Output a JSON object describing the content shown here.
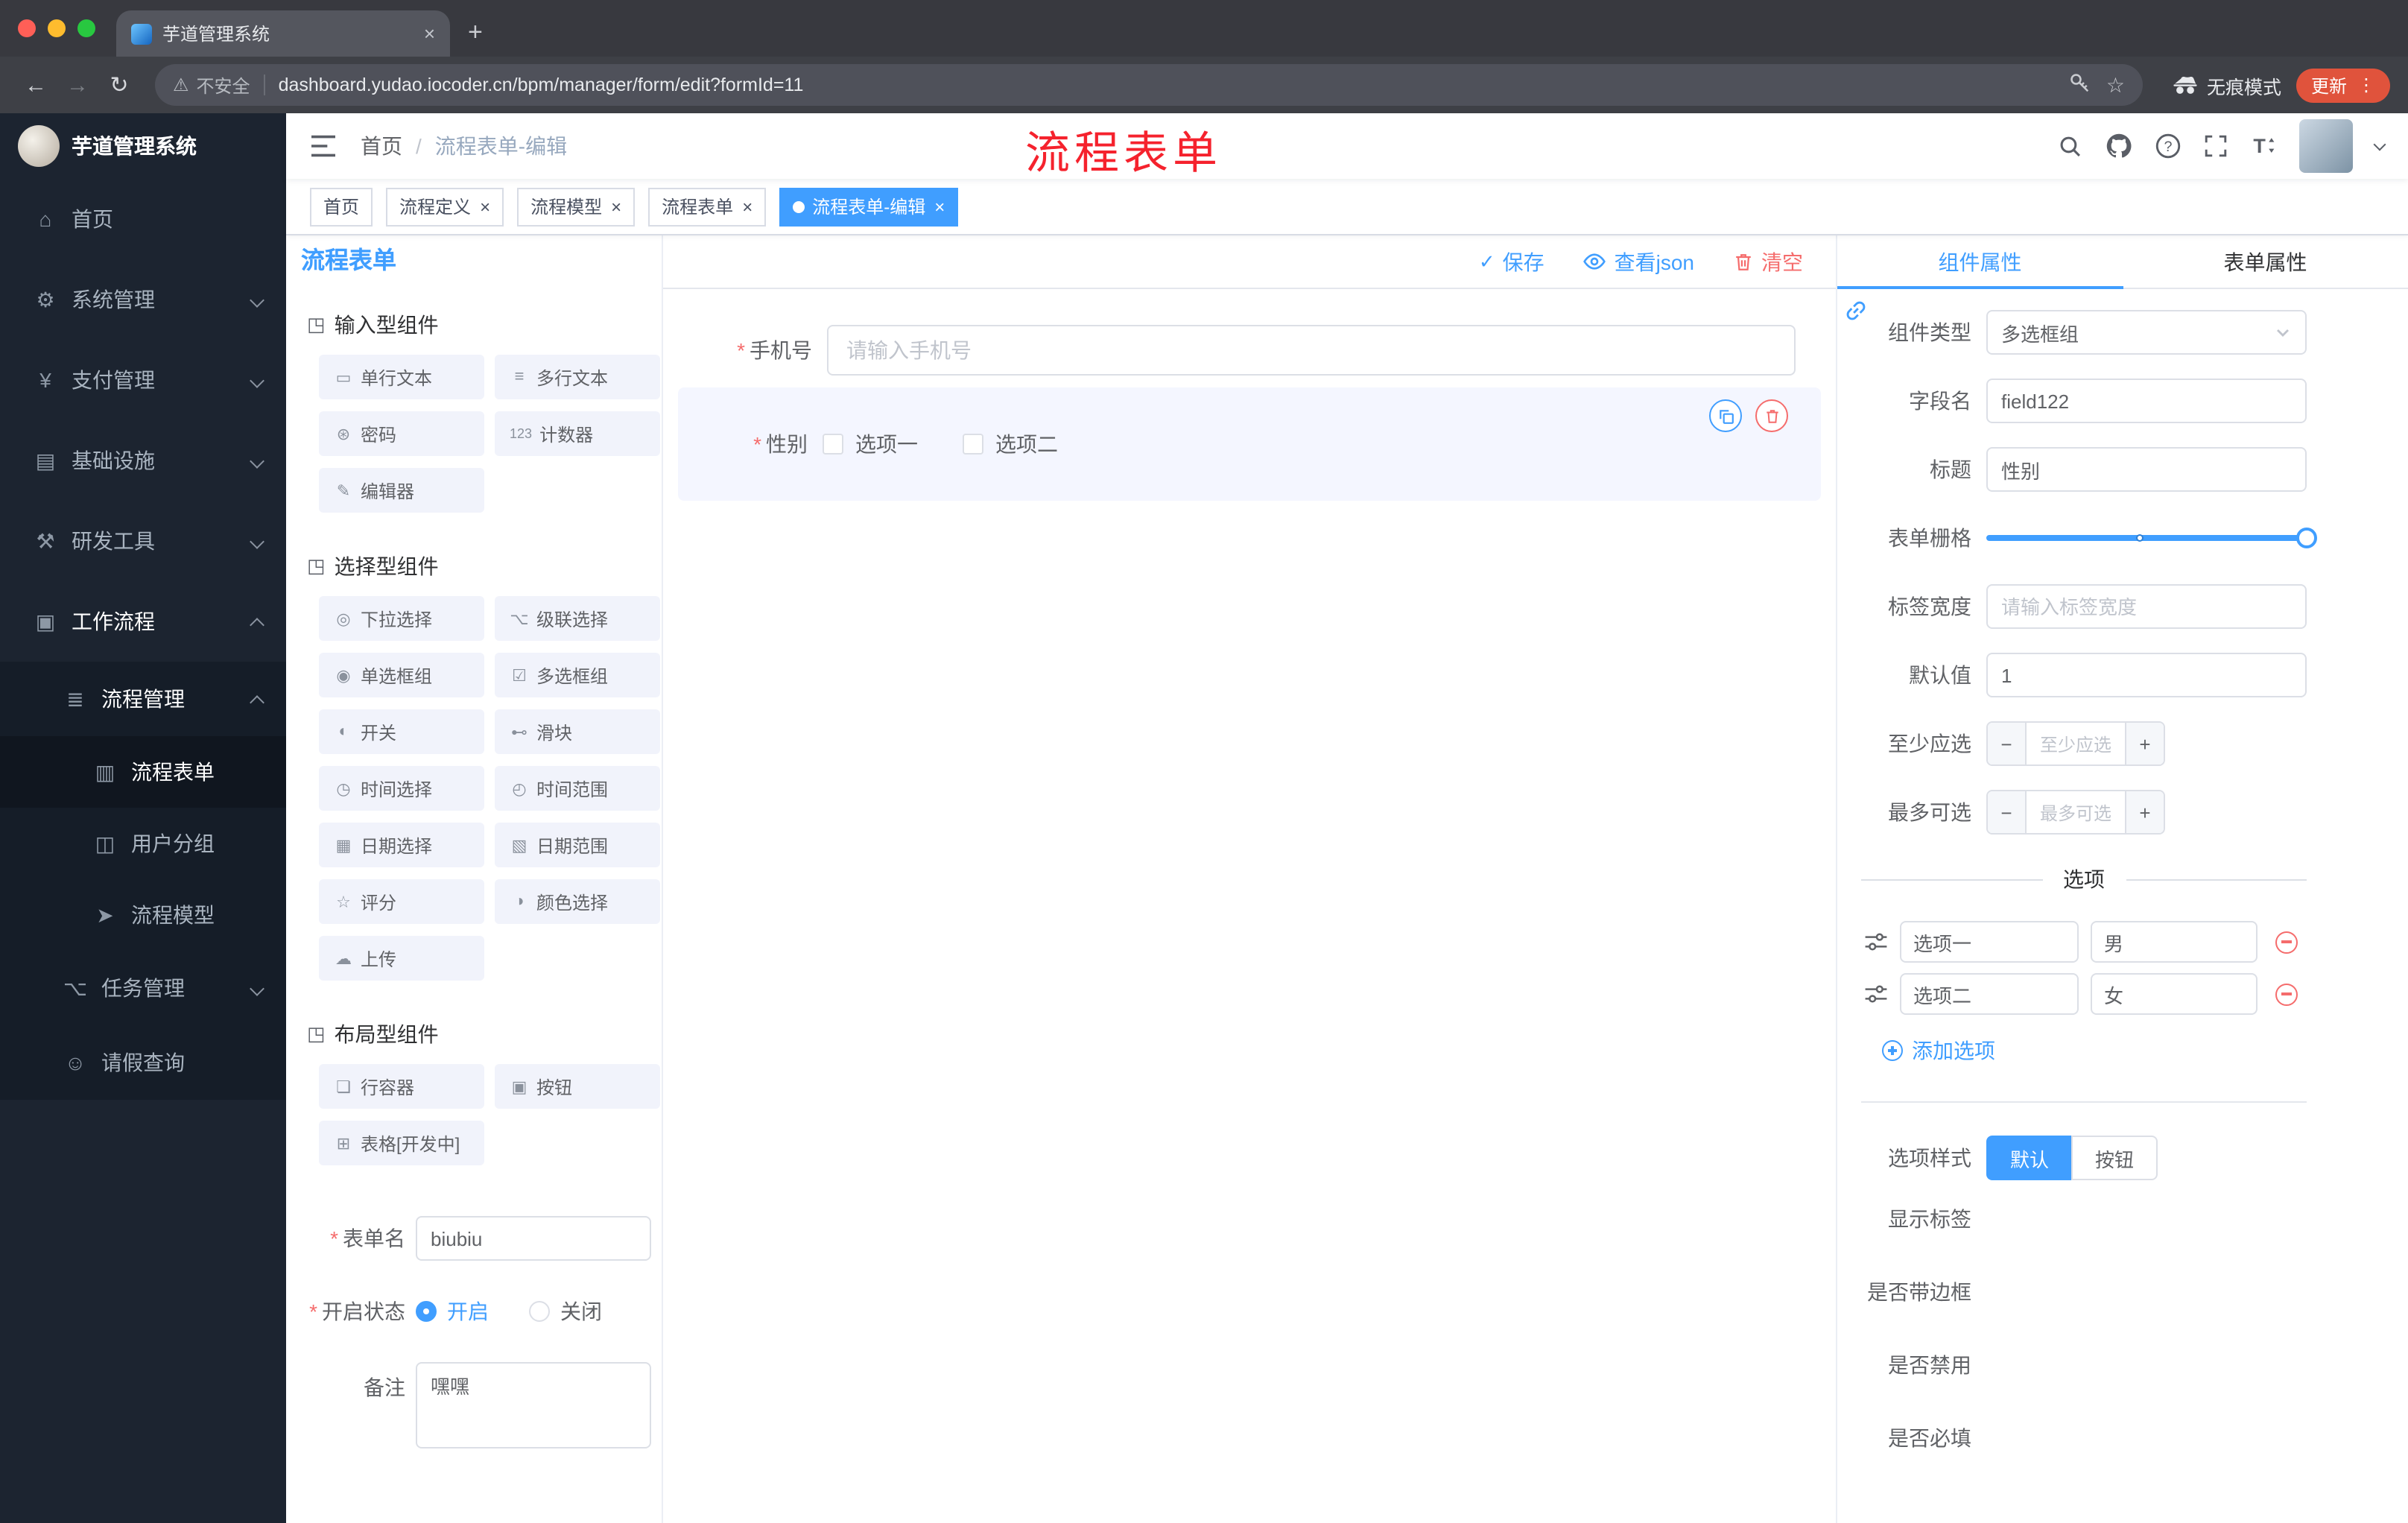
{
  "colors": {
    "primary": "#409eff",
    "danger": "#f56c6c",
    "tag_active": "#409eff",
    "annotation": "#f5222d",
    "update_button": "#e0533c",
    "sidebar_bg": "#1c2430"
  },
  "glyphs": {
    "close": "×",
    "plus": "+",
    "minus": "−",
    "dots": "⋮",
    "check": "✓",
    "back": "←",
    "forward": "→",
    "reload": "↻",
    "warning": "⚠",
    "star": "☆"
  },
  "browser": {
    "tab_title": "芋道管理系统",
    "security_text": "不安全",
    "url": "dashboard.yudao.iocoder.cn/bpm/manager/form/edit?formId=11",
    "incognito_label": "无痕模式",
    "update_label": "更新"
  },
  "sidebar": {
    "app_title": "芋道管理系统",
    "menu": [
      {
        "label": "首页",
        "icon": "⌂"
      },
      {
        "label": "系统管理",
        "icon": "⚙"
      },
      {
        "label": "支付管理",
        "icon": "¥"
      },
      {
        "label": "基础设施",
        "icon": "▤"
      },
      {
        "label": "研发工具",
        "icon": "⚒"
      },
      {
        "label": "工作流程",
        "icon": "▣"
      },
      {
        "label": "流程管理",
        "icon": "≣"
      },
      {
        "label": "流程表单",
        "icon": "▥"
      },
      {
        "label": "用户分组",
        "icon": "◫"
      },
      {
        "label": "流程模型",
        "icon": "➤"
      },
      {
        "label": "任务管理",
        "icon": "⌥"
      },
      {
        "label": "请假查询",
        "icon": "☺"
      }
    ]
  },
  "navbar": {
    "breadcrumb": [
      "首页",
      "流程表单-编辑"
    ],
    "separator": "/",
    "annotation": "流程表单"
  },
  "tags": [
    {
      "label": "首页",
      "closable": false,
      "active": false
    },
    {
      "label": "流程定义",
      "closable": true,
      "active": false
    },
    {
      "label": "流程模型",
      "closable": true,
      "active": false
    },
    {
      "label": "流程表单",
      "closable": true,
      "active": false
    },
    {
      "label": "流程表单-编辑",
      "closable": true,
      "active": true
    }
  ],
  "designer": {
    "panel_title": "流程表单",
    "toolbar": {
      "save": "保存",
      "view_json": "查看json",
      "clear": "清空"
    },
    "groups": [
      {
        "icon": "◳",
        "title": "输入型组件",
        "items": [
          {
            "icon": "▭",
            "label": "单行文本"
          },
          {
            "icon": "≡",
            "label": "多行文本"
          },
          {
            "icon": "⊛",
            "label": "密码"
          },
          {
            "icon": "123",
            "label": "计数器"
          },
          {
            "icon": "✎",
            "label": "编辑器"
          }
        ]
      },
      {
        "icon": "◳",
        "title": "选择型组件",
        "items": [
          {
            "icon": "◎",
            "label": "下拉选择"
          },
          {
            "icon": "⌥",
            "label": "级联选择"
          },
          {
            "icon": "◉",
            "label": "单选框组"
          },
          {
            "icon": "☑",
            "label": "多选框组"
          },
          {
            "icon": "◐",
            "label": "开关"
          },
          {
            "icon": "⊷",
            "label": "滑块"
          },
          {
            "icon": "◷",
            "label": "时间选择"
          },
          {
            "icon": "◴",
            "label": "时间范围"
          },
          {
            "icon": "▦",
            "label": "日期选择"
          },
          {
            "icon": "▧",
            "label": "日期范围"
          },
          {
            "icon": "☆",
            "label": "评分"
          },
          {
            "icon": "◑",
            "label": "颜色选择"
          },
          {
            "icon": "☁",
            "label": "上传"
          }
        ]
      },
      {
        "icon": "◳",
        "title": "布局型组件",
        "items": [
          {
            "icon": "❏",
            "label": "行容器"
          },
          {
            "icon": "▣",
            "label": "按钮"
          },
          {
            "icon": "⊞",
            "label": "表格[开发中]"
          }
        ]
      }
    ],
    "form_meta": {
      "name_label": "表单名",
      "name_value": "biubiu",
      "status_label": "开启状态",
      "status_on": "开启",
      "status_off": "关闭",
      "remark_label": "备注",
      "remark_value": "嘿嘿"
    },
    "canvas": {
      "phone_label": "手机号",
      "phone_placeholder": "请输入手机号",
      "gender_label": "性别",
      "gender_options": [
        "选项一",
        "选项二"
      ]
    }
  },
  "properties": {
    "tabs": [
      "组件属性",
      "表单属性"
    ],
    "rows": {
      "component_type": {
        "label": "组件类型",
        "value": "多选框组"
      },
      "field_name": {
        "label": "字段名",
        "value": "field122"
      },
      "title": {
        "label": "标题",
        "value": "性别"
      },
      "grid": {
        "label": "表单栅格"
      },
      "label_width": {
        "label": "标签宽度",
        "placeholder": "请输入标签宽度"
      },
      "default": {
        "label": "默认值",
        "value": "1"
      },
      "min": {
        "label": "至少应选",
        "placeholder": "至少应选"
      },
      "max": {
        "label": "最多可选",
        "placeholder": "最多可选"
      }
    },
    "options_divider": "选项",
    "options": [
      {
        "label": "选项一",
        "value": "男"
      },
      {
        "label": "选项二",
        "value": "女"
      }
    ],
    "add_option": "添加选项",
    "option_style": {
      "label": "选项样式",
      "default": "默认",
      "button": "按钮"
    },
    "switches": [
      {
        "label": "显示标签",
        "on": true
      },
      {
        "label": "是否带边框",
        "on": false
      },
      {
        "label": "是否禁用",
        "on": false
      },
      {
        "label": "是否必填",
        "on": true
      }
    ]
  }
}
